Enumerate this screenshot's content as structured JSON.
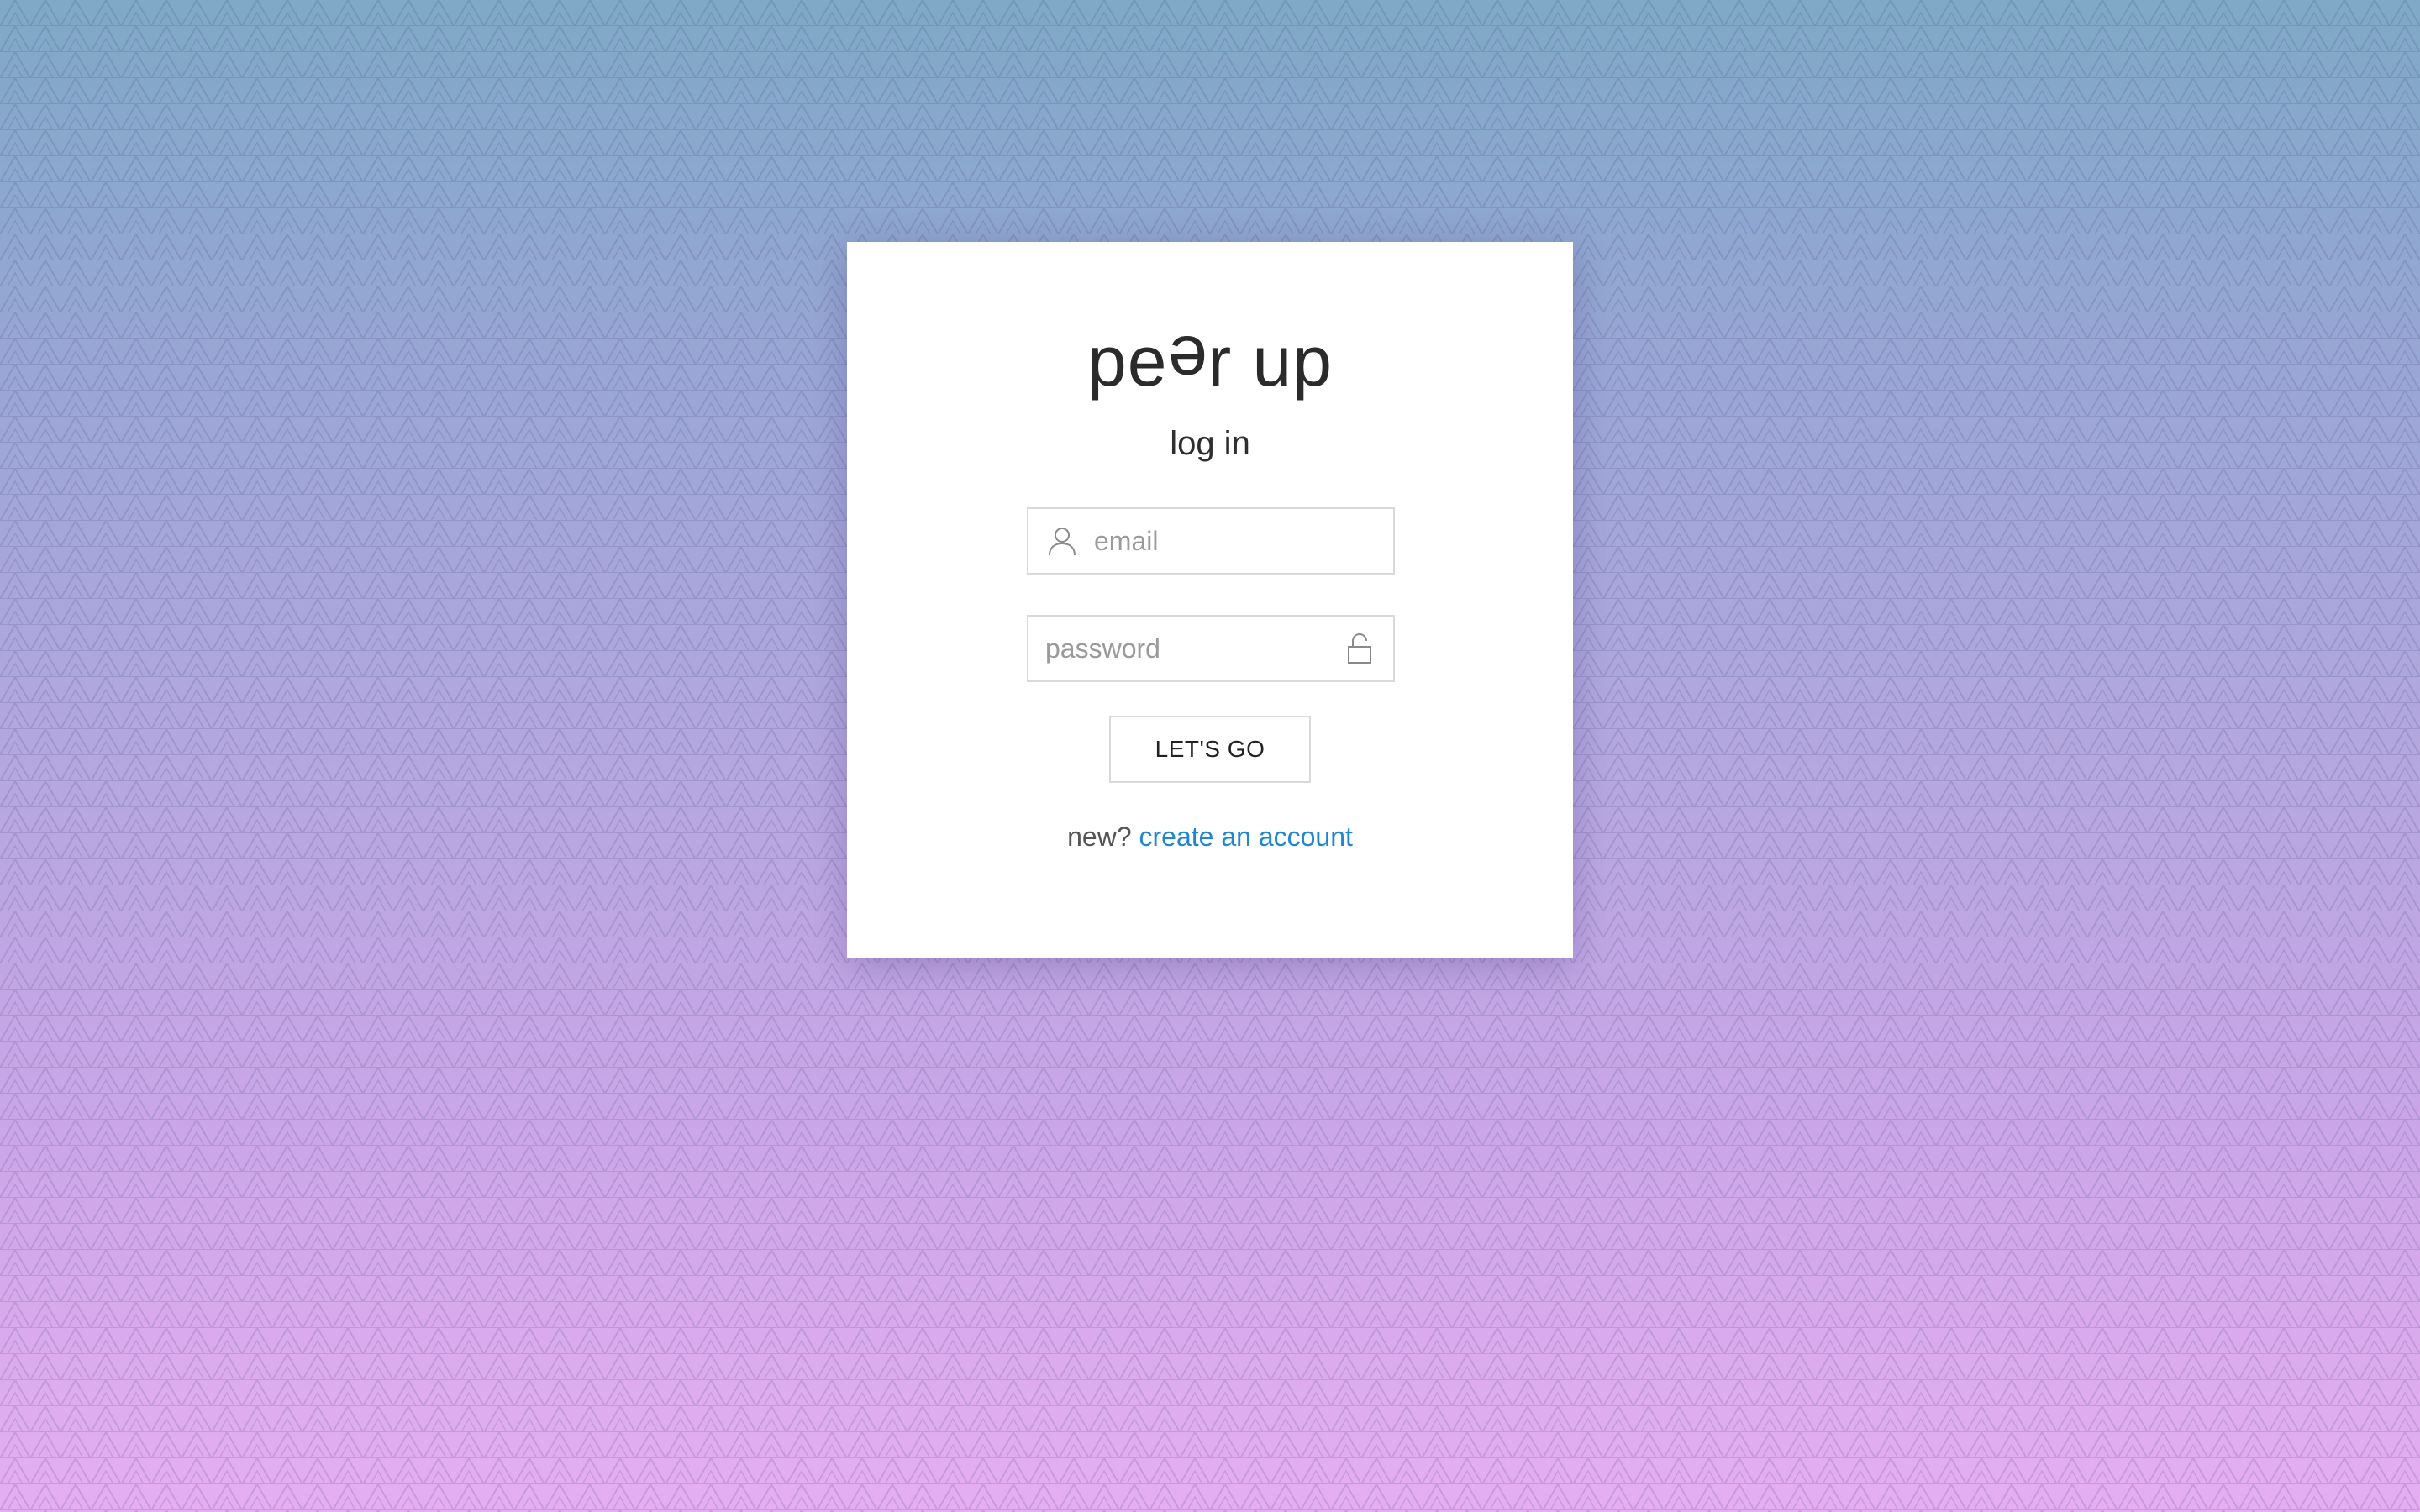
{
  "app": {
    "logo_part1": "pe",
    "logo_flipped": "e",
    "logo_part2": "r up"
  },
  "login": {
    "heading": "log in",
    "email_placeholder": "email",
    "email_value": "",
    "password_placeholder": "password",
    "password_value": "",
    "submit_label": "LET'S GO",
    "signup_prompt": "new?",
    "signup_link": "create an account"
  },
  "icons": {
    "email": "user-icon",
    "password": "lock-icon"
  },
  "colors": {
    "link": "#1f86d0",
    "background_top": "#7fa9c6",
    "background_bottom": "#e6aef2",
    "card": "#ffffff",
    "text": "#2b2b2b"
  }
}
